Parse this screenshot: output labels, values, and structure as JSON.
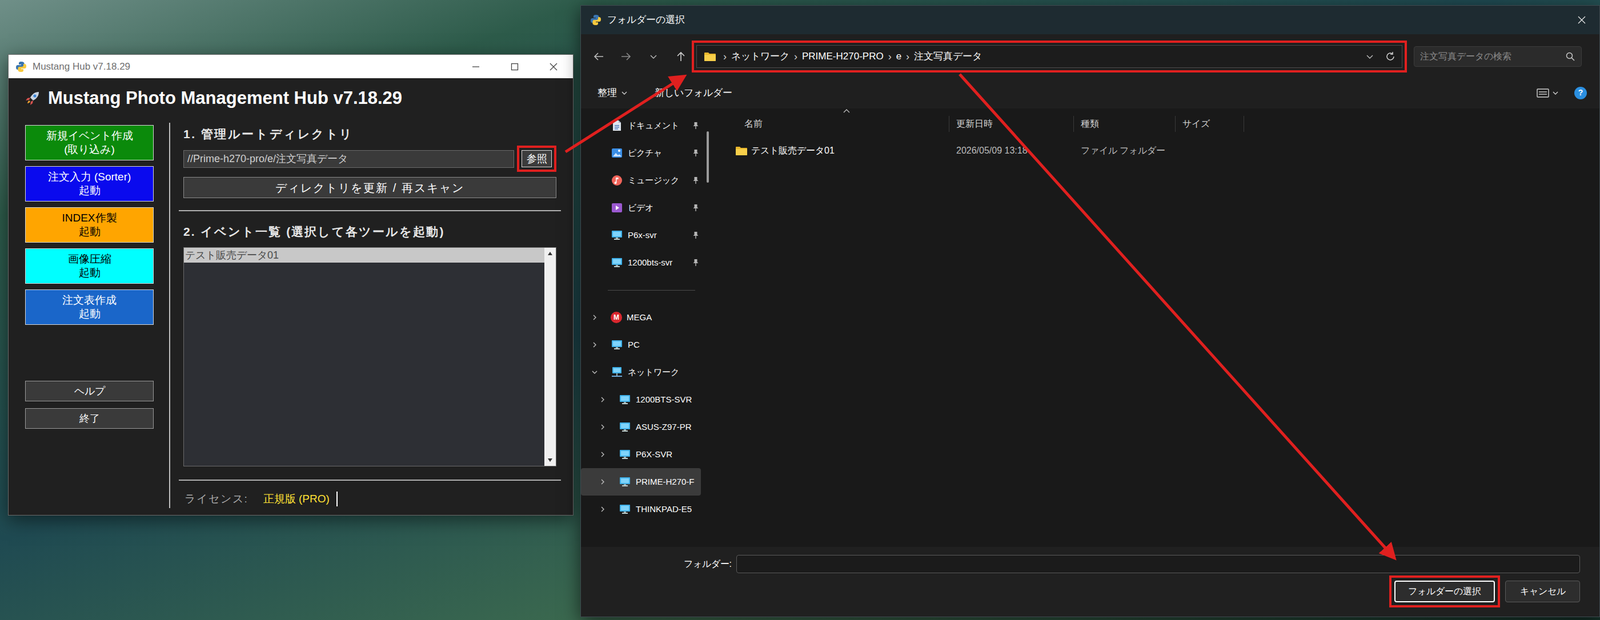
{
  "hub": {
    "window": {
      "title": "Mustang Hub v7.18.29"
    },
    "header": {
      "title": "Mustang Photo Management Hub v7.18.29"
    },
    "tools": [
      {
        "lines": [
          "新規イベント作成",
          "(取り込み)"
        ],
        "color": "#0b8a0b"
      },
      {
        "lines": [
          "注文入力 (Sorter)",
          "起動"
        ],
        "color": "#0a0aee"
      },
      {
        "lines": [
          "INDEX作製",
          "起動"
        ],
        "color": "#ffa500"
      },
      {
        "lines": [
          "画像圧縮",
          "起動"
        ],
        "color": "#00ffff"
      },
      {
        "lines": [
          "注文表作成",
          "起動"
        ],
        "color": "#1a66c9"
      }
    ],
    "utility_buttons": [
      "ヘルプ",
      "終了"
    ],
    "root": {
      "heading": "1. 管理ルートディレクトリ",
      "path": "//Prime-h270-pro/e/注文写真データ",
      "browse": {
        "label": "参照",
        "highlighted": true
      },
      "rescan": "ディレクトリを更新 / 再スキャン"
    },
    "events": {
      "heading": "2. イベント一覧 (選択して各ツールを起動)",
      "items": [
        {
          "name": "テスト販売データ01",
          "selected": true
        }
      ]
    },
    "license": {
      "label": "ライセンス:",
      "value": "正規版 (PRO)"
    }
  },
  "dialog": {
    "window": {
      "title": "フォルダーの選択"
    },
    "address": {
      "separator": "›",
      "segments": [
        "ネットワーク",
        "PRIME-H270-PRO",
        "e",
        "注文写真データ"
      ],
      "highlighted": true
    },
    "search": {
      "placeholder": "注文写真データの検索"
    },
    "toolbar": {
      "organize": "整理",
      "new_folder": "新しいフォルダー",
      "help": "?"
    },
    "nav": {
      "quick_access": [
        {
          "label": "ドキュメント",
          "kind": "documents",
          "pinned": true
        },
        {
          "label": "ピクチャ",
          "kind": "pictures",
          "pinned": true
        },
        {
          "label": "ミュージック",
          "kind": "music",
          "pinned": true
        },
        {
          "label": "ビデオ",
          "kind": "videos",
          "pinned": true
        },
        {
          "label": "P6x-svr",
          "kind": "server",
          "pinned": true
        },
        {
          "label": "1200bts-svr",
          "kind": "server",
          "pinned": true
        }
      ],
      "tree": [
        {
          "label": "MEGA",
          "kind": "mega",
          "logo": "M",
          "expanded": false,
          "selected": false
        },
        {
          "label": "PC",
          "kind": "pc",
          "expanded": false,
          "selected": false
        },
        {
          "label": "ネットワーク",
          "kind": "network",
          "expanded": true,
          "selected": false,
          "children": [
            {
              "label": "1200BTS-SVR",
              "kind": "computer",
              "expanded": false,
              "selected": false
            },
            {
              "label": "ASUS-Z97-PR",
              "kind": "computer",
              "expanded": false,
              "selected": false
            },
            {
              "label": "P6X-SVR",
              "kind": "computer",
              "expanded": false,
              "selected": false
            },
            {
              "label": "PRIME-H270-F",
              "kind": "computer",
              "expanded": false,
              "selected": true
            },
            {
              "label": "THINKPAD-E5",
              "kind": "computer",
              "expanded": false,
              "selected": false
            }
          ]
        }
      ]
    },
    "columns": [
      "名前",
      "更新日時",
      "種類",
      "サイズ"
    ],
    "rows": [
      {
        "name": "テスト販売データ01",
        "modified": "2026/05/09 13:18",
        "type": "ファイル フォルダー"
      }
    ],
    "folder_field": {
      "label": "フォルダー:",
      "value": ""
    },
    "buttons": [
      {
        "label": "フォルダーの選択",
        "highlighted": true,
        "default": true
      },
      {
        "label": "キャンセル",
        "highlighted": false,
        "default": false
      }
    ]
  }
}
